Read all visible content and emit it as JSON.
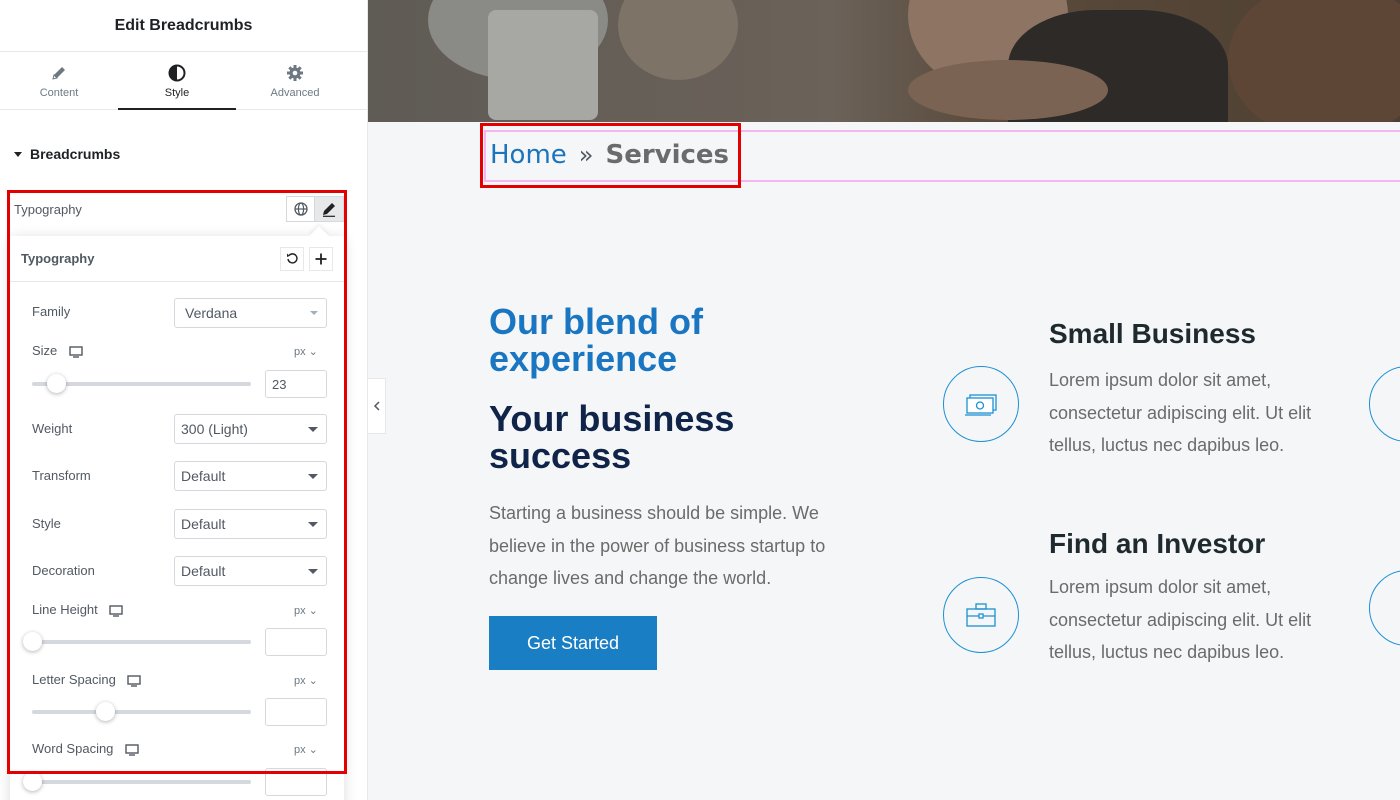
{
  "panel": {
    "title": "Edit Breadcrumbs",
    "tabs": [
      {
        "label": "Content",
        "icon": "pencil-icon"
      },
      {
        "label": "Style",
        "icon": "half-circle-icon"
      },
      {
        "label": "Advanced",
        "icon": "gear-icon"
      }
    ],
    "active_tab": "Style",
    "section_title": "Breadcrumbs",
    "typography_label": "Typography",
    "popover": {
      "title": "Typography",
      "family": {
        "label": "Family",
        "value": "Verdana"
      },
      "size": {
        "label": "Size",
        "unit": "px",
        "value": "23"
      },
      "weight": {
        "label": "Weight",
        "value": "300 (Light)"
      },
      "transform": {
        "label": "Transform",
        "value": "Default"
      },
      "style": {
        "label": "Style",
        "value": "Default"
      },
      "decoration": {
        "label": "Decoration",
        "value": "Default"
      },
      "line_height": {
        "label": "Line Height",
        "unit": "px",
        "value": ""
      },
      "letter_spacing": {
        "label": "Letter Spacing",
        "unit": "px",
        "value": ""
      },
      "word_spacing": {
        "label": "Word Spacing",
        "unit": "px",
        "value": ""
      }
    }
  },
  "preview": {
    "breadcrumb": {
      "home": "Home",
      "separator": "»",
      "current": "Services"
    },
    "heading_blend": "Our blend of experience",
    "heading_success": "Your business success",
    "intro": "Starting a business should be simple. We believe in the power of business startup to change lives and change the world.",
    "cta_label": "Get Started",
    "features": [
      {
        "title": "Small Business",
        "text": "Lorem ipsum dolor sit amet, consectetur adipiscing elit. Ut elit tellus, luctus nec dapibus leo.",
        "icon": "money-icon"
      },
      {
        "title": "Find an Investor",
        "text": "Lorem ipsum dolor sit amet, consectetur adipiscing elit. Ut elit tellus, luctus nec dapibus leo.",
        "icon": "briefcase-icon"
      }
    ]
  },
  "colors": {
    "highlight": "#e30000",
    "accent": "#1b76c2",
    "dark_heading": "#102348",
    "button": "#1a7ec4"
  }
}
